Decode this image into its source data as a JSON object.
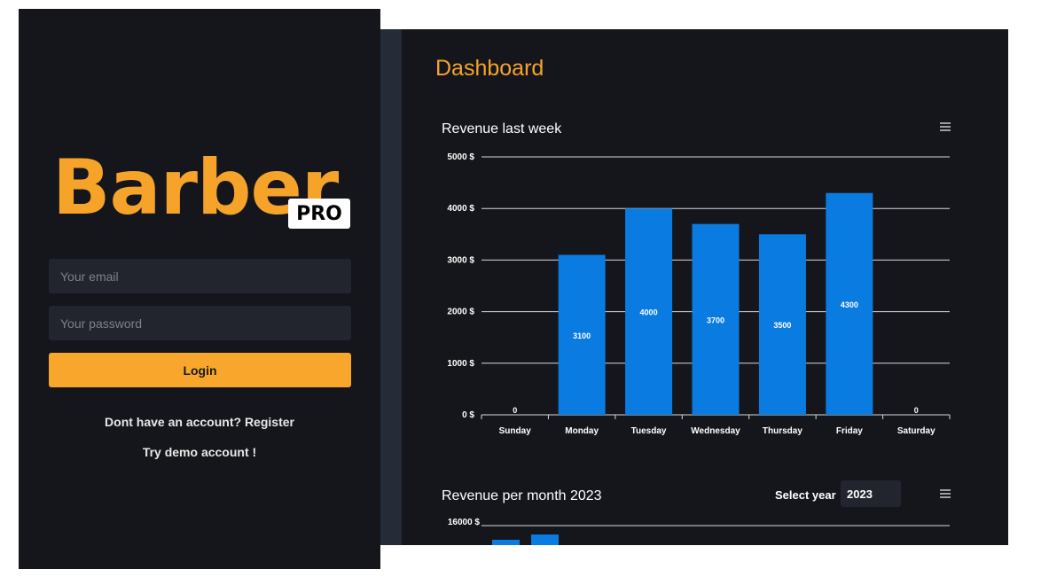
{
  "login": {
    "logo_text": "Barber",
    "logo_badge": "PRO",
    "email_placeholder": "Your email",
    "password_placeholder": "Your password",
    "login_button": "Login",
    "register_text": "Dont have an account? Register",
    "demo_text": "Try demo account !"
  },
  "dashboard": {
    "title": "Dashboard",
    "year_label": "Select year",
    "year_value": "2023",
    "menu_icon": "hamburger-menu-icon"
  },
  "colors": {
    "accent": "#f6a32a",
    "bar": "#0a7be0",
    "panel_bg": "#15161c",
    "input_bg": "#22252e"
  },
  "chart_data": [
    {
      "type": "bar",
      "title": "Revenue last week",
      "categories": [
        "Sunday",
        "Monday",
        "Tuesday",
        "Wednesday",
        "Thursday",
        "Friday",
        "Saturday"
      ],
      "values": [
        0,
        3100,
        4000,
        3700,
        3500,
        4300,
        0
      ],
      "y_ticks": [
        "0 $",
        "1000 $",
        "2000 $",
        "3000 $",
        "4000 $",
        "5000 $"
      ],
      "ylim": [
        0,
        5000
      ],
      "grid": true
    },
    {
      "type": "bar",
      "title": "Revenue per month 2023",
      "y_ticks": [
        "16000 $"
      ],
      "grid": true
    }
  ]
}
